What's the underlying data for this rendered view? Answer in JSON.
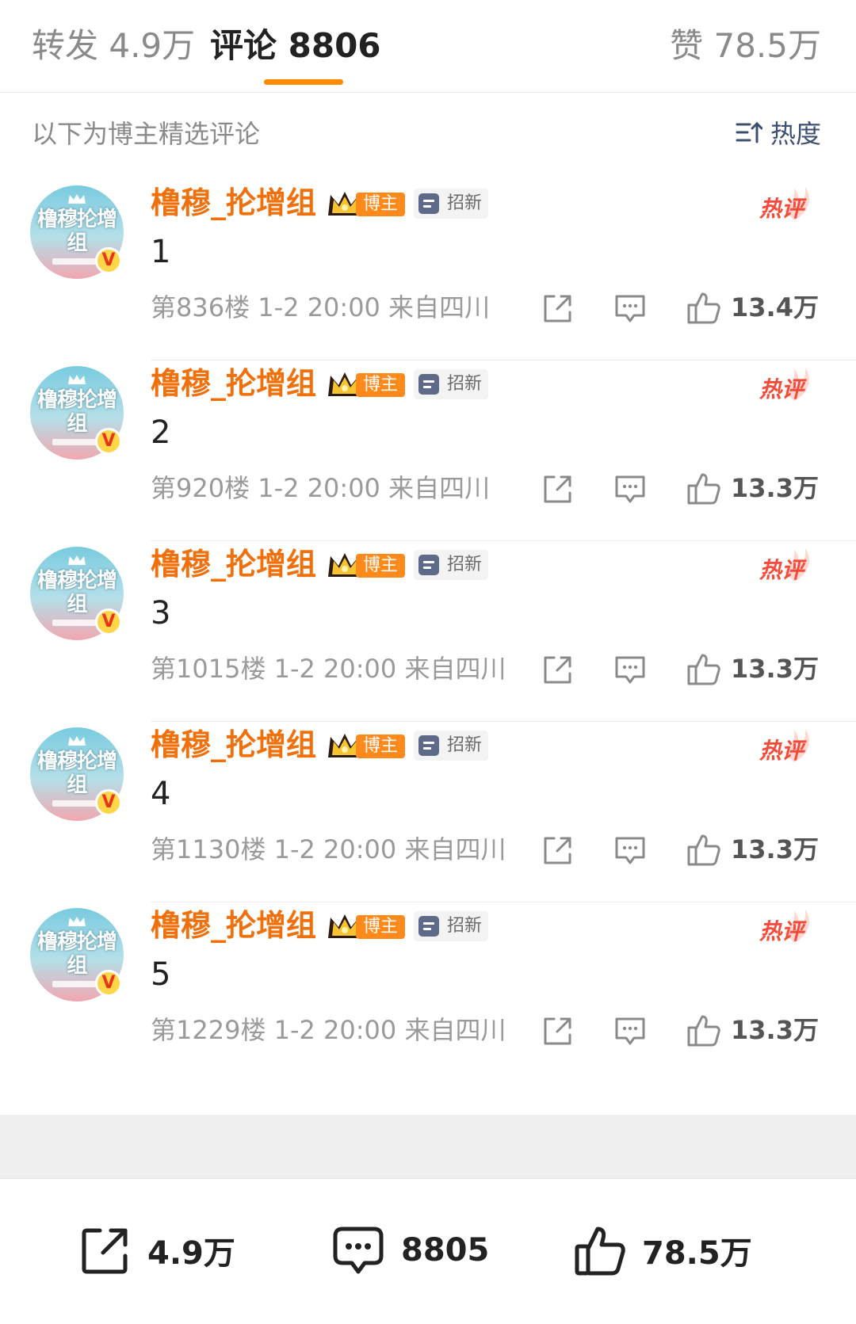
{
  "tabs": {
    "repost": "转发 4.9万",
    "comments": "评论 8806",
    "likes": "赞 78.5万"
  },
  "subheader": {
    "text": "以下为博主精选评论",
    "sort_label": "热度"
  },
  "comments": [
    {
      "username": "橹穆_抡增组",
      "owner_badge": "博主",
      "tag": "招新",
      "hot_label": "热评",
      "text": "1",
      "meta": "第836楼 1-2 20:00 来自四川",
      "likes": "13.4万"
    },
    {
      "username": "橹穆_抡增组",
      "owner_badge": "博主",
      "tag": "招新",
      "hot_label": "热评",
      "text": "2",
      "meta": "第920楼 1-2 20:00 来自四川",
      "likes": "13.3万"
    },
    {
      "username": "橹穆_抡增组",
      "owner_badge": "博主",
      "tag": "招新",
      "hot_label": "热评",
      "text": "3",
      "meta": "第1015楼 1-2 20:00 来自四川",
      "likes": "13.3万"
    },
    {
      "username": "橹穆_抡增组",
      "owner_badge": "博主",
      "tag": "招新",
      "hot_label": "热评",
      "text": "4",
      "meta": "第1130楼 1-2 20:00 来自四川",
      "likes": "13.3万"
    },
    {
      "username": "橹穆_抡增组",
      "owner_badge": "博主",
      "tag": "招新",
      "hot_label": "热评",
      "text": "5",
      "meta": "第1229楼 1-2 20:00 来自四川",
      "likes": "13.3万"
    }
  ],
  "avatar_text": "橹穆抡增组",
  "bottom_bar": {
    "repost_count": "4.9万",
    "comment_count": "8805",
    "like_count": "78.5万"
  },
  "colors": {
    "accent": "#ff8a00",
    "username": "#f0700b",
    "hot": "#f54b3b",
    "sort": "#3c4e70",
    "owner_badge": "#ff8a1c",
    "vbadge": "#ffd54a"
  },
  "icons": {
    "sort": "sort-icon",
    "share": "share-icon",
    "comment": "comment-icon",
    "like": "thumbs-up-icon",
    "crown": "crown-icon",
    "verified": "verified-v-icon",
    "hot": "flame-icon"
  }
}
